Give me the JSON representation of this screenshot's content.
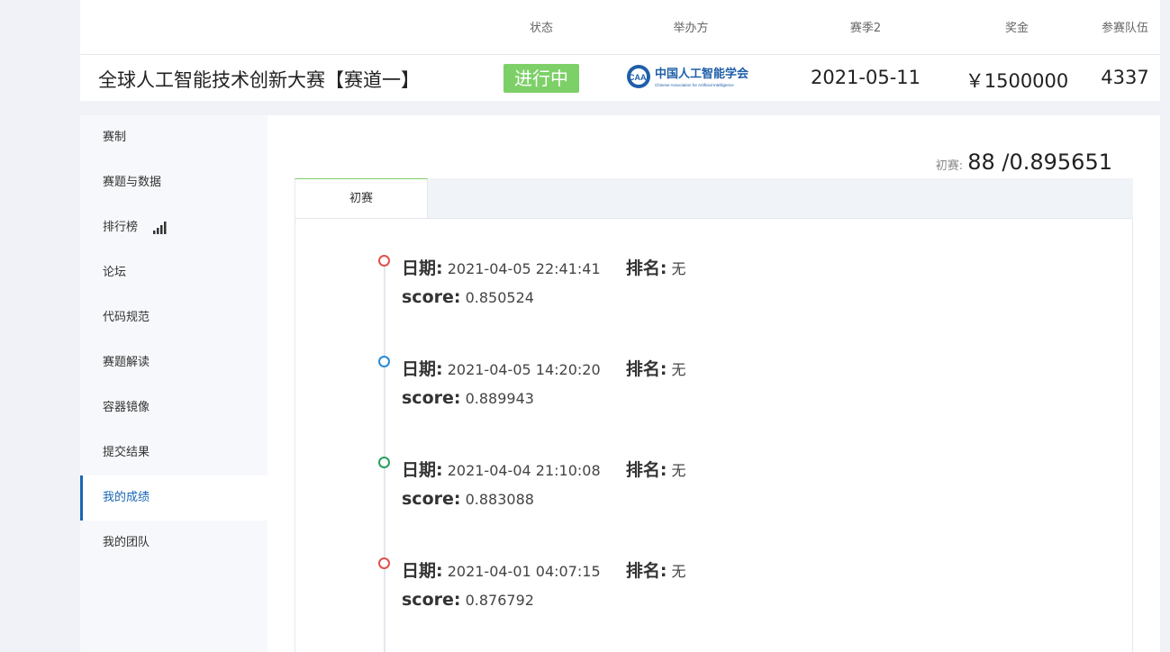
{
  "header": {
    "col_status": "状态",
    "col_organizer": "举办方",
    "col_season": "赛季2",
    "col_prize": "奖金",
    "col_teams": "参赛队伍",
    "competition_title": "全球人工智能技术创新大赛【赛道一】",
    "status": "进行中",
    "status_color": "#7dd068",
    "organizer_logo_text": "中国人工智能学会",
    "organizer_logo_subtext": "Chinese Association for Artificial Intelligence",
    "organizer_logo_mark": "CAAI",
    "season_date": "2021-05-11",
    "prize": "￥1500000",
    "teams": "4337"
  },
  "sidebar": {
    "items": [
      {
        "label": "赛制"
      },
      {
        "label": "赛题与数据"
      },
      {
        "label": "排行榜",
        "icon": "bar-chart-icon"
      },
      {
        "label": "论坛"
      },
      {
        "label": "代码规范"
      },
      {
        "label": "赛题解读"
      },
      {
        "label": "容器镜像"
      },
      {
        "label": "提交结果"
      },
      {
        "label": "我的成绩",
        "active": true
      },
      {
        "label": "我的团队"
      }
    ],
    "active_color": "#1a66b3"
  },
  "main": {
    "summary_label": "初赛:",
    "summary_value": "88 /0.895651",
    "tabs": [
      {
        "label": "初赛",
        "active": true
      }
    ],
    "date_label": "日期:",
    "rank_label": "排名:",
    "score_label": "score:",
    "entries": [
      {
        "date": "2021-04-05 22:41:41",
        "rank": "无",
        "score": "0.850524",
        "dot_color": "#e05050"
      },
      {
        "date": "2021-04-05 14:20:20",
        "rank": "无",
        "score": "0.889943",
        "dot_color": "#2a8ad4"
      },
      {
        "date": "2021-04-04 21:10:08",
        "rank": "无",
        "score": "0.883088",
        "dot_color": "#2aa05a"
      },
      {
        "date": "2021-04-01 04:07:15",
        "rank": "无",
        "score": "0.876792",
        "dot_color": "#e05050"
      }
    ]
  }
}
